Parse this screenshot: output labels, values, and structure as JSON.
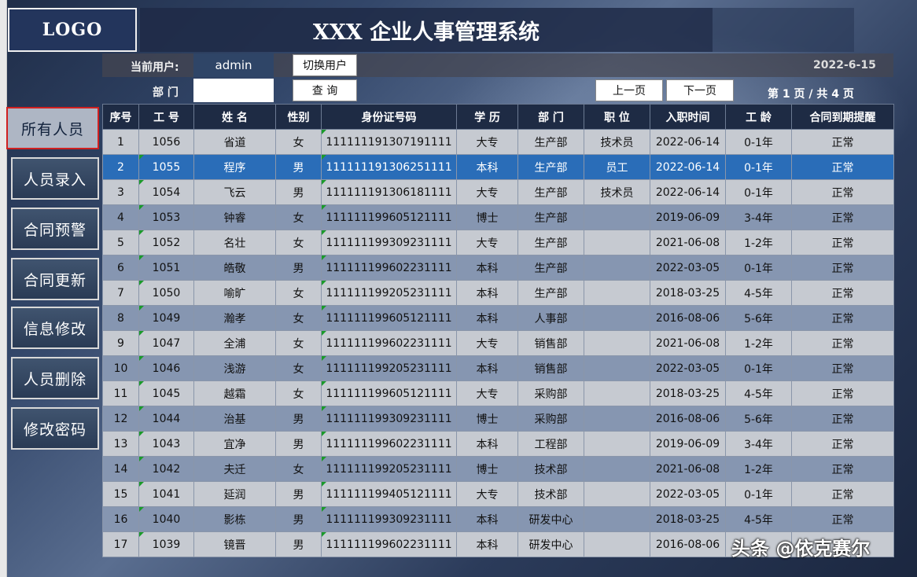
{
  "header": {
    "logo": "LOGO",
    "title": "XXX 企业人事管理系统"
  },
  "info": {
    "current_user_label": "当前用户:",
    "current_user": "admin",
    "switch_user_label": "切换用户",
    "date": "2022-6-15",
    "dept_label": "部 门",
    "dept_value": "",
    "query_label": "查 询",
    "prev_page_label": "上一页",
    "next_page_label": "下一页",
    "page_info": "第 1 页 / 共 4 页"
  },
  "sidebar": {
    "items": [
      {
        "label": "所有人员",
        "active": true
      },
      {
        "label": "人员录入"
      },
      {
        "label": "合同预警"
      },
      {
        "label": "合同更新"
      },
      {
        "label": "信息修改"
      },
      {
        "label": "人员删除"
      },
      {
        "label": "修改密码"
      }
    ]
  },
  "table": {
    "columns": [
      "序号",
      "工 号",
      "姓 名",
      "性别",
      "身份证号码",
      "学 历",
      "部 门",
      "职 位",
      "入职时间",
      "工 龄",
      "合同到期提醒"
    ],
    "rows": [
      [
        "1",
        "1056",
        "省道",
        "女",
        "111111191307191111",
        "大专",
        "生产部",
        "技术员",
        "2022-06-14",
        "0-1年",
        "正常"
      ],
      [
        "2",
        "1055",
        "程序",
        "男",
        "111111191306251111",
        "本科",
        "生产部",
        "员工",
        "2022-06-14",
        "0-1年",
        "正常"
      ],
      [
        "3",
        "1054",
        "飞云",
        "男",
        "111111191306181111",
        "大专",
        "生产部",
        "技术员",
        "2022-06-14",
        "0-1年",
        "正常"
      ],
      [
        "4",
        "1053",
        "钟睿",
        "女",
        "111111199605121111",
        "博士",
        "生产部",
        "",
        "2019-06-09",
        "3-4年",
        "正常"
      ],
      [
        "5",
        "1052",
        "名壮",
        "女",
        "111111199309231111",
        "大专",
        "生产部",
        "",
        "2021-06-08",
        "1-2年",
        "正常"
      ],
      [
        "6",
        "1051",
        "皓敬",
        "男",
        "111111199602231111",
        "本科",
        "生产部",
        "",
        "2022-03-05",
        "0-1年",
        "正常"
      ],
      [
        "7",
        "1050",
        "喻旷",
        "女",
        "111111199205231111",
        "本科",
        "生产部",
        "",
        "2018-03-25",
        "4-5年",
        "正常"
      ],
      [
        "8",
        "1049",
        "瀚孝",
        "女",
        "111111199605121111",
        "本科",
        "人事部",
        "",
        "2016-08-06",
        "5-6年",
        "正常"
      ],
      [
        "9",
        "1047",
        "全浦",
        "女",
        "111111199602231111",
        "大专",
        "销售部",
        "",
        "2021-06-08",
        "1-2年",
        "正常"
      ],
      [
        "10",
        "1046",
        "浅游",
        "女",
        "111111199205231111",
        "本科",
        "销售部",
        "",
        "2022-03-05",
        "0-1年",
        "正常"
      ],
      [
        "11",
        "1045",
        "越霜",
        "女",
        "111111199605121111",
        "大专",
        "采购部",
        "",
        "2018-03-25",
        "4-5年",
        "正常"
      ],
      [
        "12",
        "1044",
        "治基",
        "男",
        "111111199309231111",
        "博士",
        "采购部",
        "",
        "2016-08-06",
        "5-6年",
        "正常"
      ],
      [
        "13",
        "1043",
        "宜净",
        "男",
        "111111199602231111",
        "本科",
        "工程部",
        "",
        "2019-06-09",
        "3-4年",
        "正常"
      ],
      [
        "14",
        "1042",
        "夫迁",
        "女",
        "111111199205231111",
        "博士",
        "技术部",
        "",
        "2021-06-08",
        "1-2年",
        "正常"
      ],
      [
        "15",
        "1041",
        "延润",
        "男",
        "111111199405121111",
        "大专",
        "技术部",
        "",
        "2022-03-05",
        "0-1年",
        "正常"
      ],
      [
        "16",
        "1040",
        "影栋",
        "男",
        "111111199309231111",
        "本科",
        "研发中心",
        "",
        "2018-03-25",
        "4-5年",
        "正常"
      ],
      [
        "17",
        "1039",
        "镜晋",
        "男",
        "111111199602231111",
        "本科",
        "研发中心",
        "",
        "2016-08-06",
        "",
        ""
      ]
    ],
    "selected_row": 1
  },
  "watermark": "头条 @依克赛尔"
}
